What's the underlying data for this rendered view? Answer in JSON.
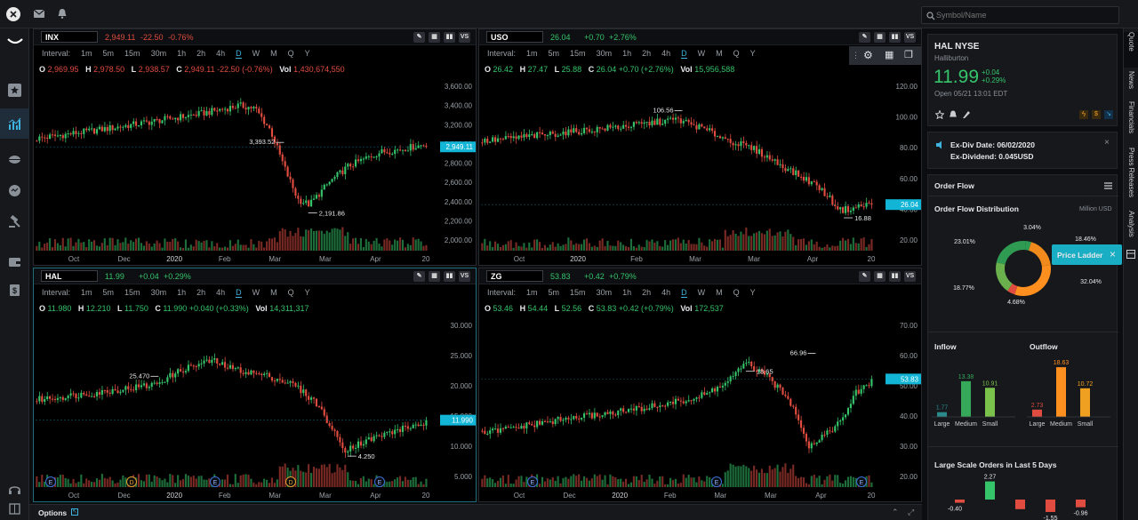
{
  "topbar": {
    "search_placeholder": "Symbol/Name"
  },
  "charts": [
    {
      "id": "inx",
      "symbol": "INX",
      "last": "2,949.11",
      "change": "-22.50",
      "change_pct": "-0.76%",
      "direction": "down",
      "intervals": [
        "Interval:",
        "1m",
        "5m",
        "15m",
        "30m",
        "1h",
        "2h",
        "4h",
        "D",
        "W",
        "M",
        "Q",
        "Y"
      ],
      "active_interval": "D",
      "ohlc": {
        "o": "2,969.95",
        "h": "2,978.50",
        "l": "2,938.57",
        "c": "2,949.11",
        "chg": "-22.50 (-0.76%)",
        "vol": "1,430,674,550"
      },
      "y_ticks": [
        "3,600.00",
        "3,400.00",
        "3,200.00",
        "3,000.00",
        "2,800.00",
        "2,600.00",
        "2,400.00",
        "2,200.00",
        "2,000.00"
      ],
      "x_ticks": [
        "Oct",
        "Dec",
        "2020",
        "Feb",
        "Mar",
        "Mar",
        "Apr",
        "20"
      ],
      "high_label": "3,393.52",
      "low_label": "2,191.86",
      "price_tag": "2,949.11"
    },
    {
      "id": "uso",
      "symbol": "USO",
      "last": "26.04",
      "change": "+0.70",
      "change_pct": "+2.76%",
      "direction": "up",
      "intervals": [
        "Interval:",
        "1m",
        "5m",
        "15m",
        "30m",
        "1h",
        "2h",
        "4h",
        "D",
        "W",
        "M",
        "Q",
        "Y"
      ],
      "active_interval": "D",
      "ohlc": {
        "o": "26.42",
        "h": "27.47",
        "l": "25.88",
        "c": "26.04",
        "chg": "+0.70 (+2.76%)",
        "vol": "15,956,588"
      },
      "y_ticks": [
        "120.00",
        "100.00",
        "80.00",
        "60.00",
        "40.00",
        "20.00"
      ],
      "x_ticks": [
        "Oct",
        "2020",
        "Feb",
        "Mar",
        "Mar",
        "Apr",
        "20"
      ],
      "high_label": "106.56",
      "low_label": "16.88",
      "price_tag": "26.04"
    },
    {
      "id": "hal",
      "symbol": "HAL",
      "last": "11.99",
      "change": "+0.04",
      "change_pct": "+0.29%",
      "direction": "up",
      "intervals": [
        "Interval:",
        "1m",
        "5m",
        "15m",
        "30m",
        "1h",
        "2h",
        "4h",
        "D",
        "W",
        "M",
        "Q",
        "Y"
      ],
      "active_interval": "D",
      "ohlc": {
        "o": "11.980",
        "h": "12.210",
        "l": "11.750",
        "c": "11.990",
        "chg": "+0.040 (+0.33%)",
        "vol": "14,311,317"
      },
      "y_ticks": [
        "30.000",
        "25.000",
        "20.000",
        "15.000",
        "10.000",
        "5.000"
      ],
      "x_ticks": [
        "Oct",
        "Dec",
        "2020",
        "Feb",
        "Mar",
        "Mar",
        "Apr",
        "20"
      ],
      "high_label": "25.470",
      "low_label": "4.250",
      "price_tag": "11.990",
      "event_markers": [
        "E",
        "D",
        "E",
        "D",
        "E"
      ]
    },
    {
      "id": "zg",
      "symbol": "ZG",
      "last": "53.83",
      "change": "+0.42",
      "change_pct": "+0.79%",
      "direction": "up",
      "intervals": [
        "Interval:",
        "1m",
        "5m",
        "15m",
        "30m",
        "1h",
        "2h",
        "4h",
        "D",
        "W",
        "M",
        "Q",
        "Y"
      ],
      "active_interval": "D",
      "ohlc": {
        "o": "53.46",
        "h": "54.44",
        "l": "52.56",
        "c": "53.83",
        "chg": "+0.42 (+0.79%)",
        "vol": "172,537"
      },
      "y_ticks": [
        "70.00",
        "60.00",
        "50.00",
        "40.00",
        "30.00",
        "20.00"
      ],
      "x_ticks": [
        "Oct",
        "Dec",
        "2020",
        "Feb",
        "Mar",
        "Mar",
        "Apr",
        "20"
      ],
      "high_label": "66.96",
      "low_label": "18.65",
      "price_tag": "53.83",
      "event_markers": [
        "E",
        "E",
        "E"
      ]
    }
  ],
  "quote": {
    "title": "HAL NYSE",
    "name": "Halliburton",
    "price": "11.99",
    "change": "+0.04",
    "change_pct": "+0.29%",
    "open_time": "Open 05/21 13:01 EDT"
  },
  "dividend": {
    "date": "Ex-Div Date: 06/02/2020",
    "amount": "Ex-Dividend: 0.045USD"
  },
  "order_flow": {
    "title": "Order Flow",
    "dist_title": "Order Flow Distribution",
    "unit": "Million USD",
    "donut": [
      {
        "label": "3.04%",
        "value": 3.04,
        "color": "#2e9a52"
      },
      {
        "label": "18.46%",
        "value": 18.46,
        "color": "#f08a1c"
      },
      {
        "label": "32.04%",
        "value": 32.04,
        "color": "#ff8f1f"
      },
      {
        "label": "4.68%",
        "value": 4.68,
        "color": "#e04c3f"
      },
      {
        "label": "18.77%",
        "value": 18.77,
        "color": "#6ab04c"
      },
      {
        "label": "23.01%",
        "value": 23.01,
        "color": "#2e9a52"
      }
    ],
    "price_ladder_label": "Price Ladder",
    "inflow": {
      "title": "Inflow",
      "categories": [
        "Large",
        "Medium",
        "Small"
      ],
      "values": [
        1.77,
        13.38,
        10.91
      ],
      "labels": [
        "1.77",
        "13.38",
        "10.91"
      ]
    },
    "outflow": {
      "title": "Outflow",
      "categories": [
        "Large",
        "Medium",
        "Small"
      ],
      "values": [
        2.73,
        18.63,
        10.72
      ],
      "labels": [
        "2.73",
        "18.63",
        "10.72"
      ]
    },
    "large_orders_title": "Large Scale Orders in Last 5 Days",
    "large_orders": [
      {
        "label": "-0.40",
        "value": -0.4
      },
      {
        "label": "2.27",
        "value": 2.27
      },
      {
        "label": "",
        "value": -1.2
      },
      {
        "label": "-1.55",
        "value": -1.55
      },
      {
        "label": "-0.96",
        "value": -0.96
      }
    ]
  },
  "vertical_tabs": [
    "Quote",
    "News",
    "Financials",
    "Press Releases",
    "Analysis"
  ],
  "bottom": {
    "options_label": "Options"
  },
  "colors": {
    "up": "#35c46a",
    "down": "#e04c3f",
    "accent": "#3fb3e0",
    "tag": "#12b5d6"
  }
}
